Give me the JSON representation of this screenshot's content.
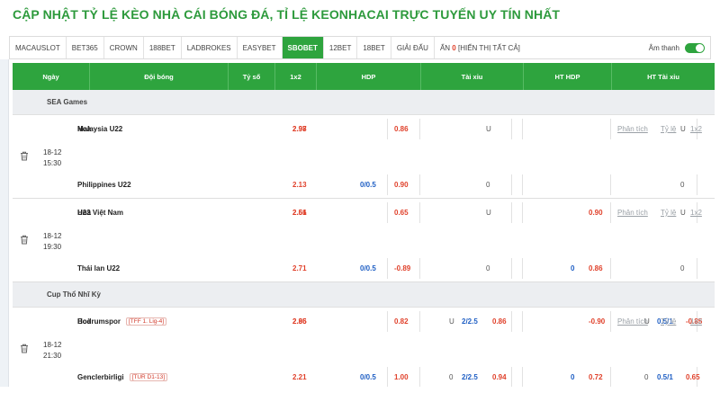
{
  "page": {
    "title": "CẬP NHẬT TỶ LỆ KÈO NHÀ CÁI BÓNG ĐÁ, TỈ LỆ KEONHACAI TRỰC TUYẾN UY TÍN NHẤT"
  },
  "tabs": [
    {
      "label": "MACAUSLOT",
      "active": false
    },
    {
      "label": "BET365",
      "active": false
    },
    {
      "label": "CROWN",
      "active": false
    },
    {
      "label": "188BET",
      "active": false
    },
    {
      "label": "LADBROKES",
      "active": false
    },
    {
      "label": "EASYBET",
      "active": false
    },
    {
      "label": "SBOBET",
      "active": true
    },
    {
      "label": "12BET",
      "active": false
    },
    {
      "label": "18BET",
      "active": false
    },
    {
      "label": "GIẢI ĐẤU",
      "active": false
    }
  ],
  "hide_bar": {
    "label": "ẨN",
    "count": "0",
    "show_all": "[HIỂN THỊ TẤT CẢ]"
  },
  "sound": {
    "label": "Âm thanh",
    "on": true
  },
  "header": {
    "date": "Ngày",
    "team": "Đội bóng",
    "score": "Tỷ số",
    "x12": "1x2",
    "hdp": "HDP",
    "ou": "Tài xỉu",
    "ht_hdp": "HT HDP",
    "ht_ou": "HT Tài xỉu"
  },
  "links": {
    "analysis": "Phân tích",
    "odds": "Tỷ lệ",
    "x12": "1x2"
  },
  "leagues": [
    {
      "name": "SEA Games",
      "matches": [
        {
          "date": "18-12",
          "time": "15:30",
          "rows": [
            {
              "team": "Philippines U22",
              "tag": "",
              "x12": "2.13",
              "hdp_line": "0/0.5",
              "hdp_odd": "0.90",
              "ou_label": "0",
              "ou_line": "",
              "ou_odd": "",
              "hthdp_line": "",
              "hthdp_odd": "",
              "htou_label": "0",
              "htou_line": "",
              "htou_odd": ""
            },
            {
              "team": "Malaysia U22",
              "tag": "",
              "x12": "2.97",
              "hdp_line": "",
              "hdp_odd": "0.86",
              "ou_label": "U",
              "ou_line": "",
              "ou_odd": "",
              "hthdp_line": "",
              "hthdp_odd": "",
              "htou_label": "U",
              "htou_line": "",
              "htou_odd": ""
            },
            {
              "team": "Hoà",
              "tag": "",
              "x12": "2.98"
            }
          ]
        }
      ]
    },
    {
      "name": "",
      "matches": [
        {
          "date": "18-12",
          "time": "19:30",
          "rows": [
            {
              "team": "Thái lan U22",
              "tag": "",
              "x12": "2.71",
              "hdp_line": "0/0.5",
              "hdp_odd": "-0.89",
              "ou_label": "0",
              "ou_line": "",
              "ou_odd": "",
              "hthdp_line": "0",
              "hthdp_odd": "0.86",
              "htou_label": "0",
              "htou_line": "",
              "htou_odd": ""
            },
            {
              "team": "U22 Việt Nam",
              "tag": "",
              "x12": "2.51",
              "hdp_line": "",
              "hdp_odd": "0.65",
              "ou_label": "U",
              "ou_line": "",
              "ou_odd": "",
              "hthdp_line": "",
              "hthdp_odd": "0.90",
              "htou_label": "U",
              "htou_line": "",
              "htou_odd": ""
            },
            {
              "team": "Hoà",
              "tag": "",
              "x12": "2.66"
            }
          ]
        }
      ]
    },
    {
      "name": "Cup Thổ Nhĩ Kỳ",
      "matches": [
        {
          "date": "18-12",
          "time": "21:30",
          "rows": [
            {
              "team": "Genclerbirligi",
              "tag": "[TUR D1-13]",
              "x12": "2.21",
              "hdp_line": "0/0.5",
              "hdp_odd": "1.00",
              "ou_label": "0",
              "ou_line": "2/2.5",
              "ou_odd": "0.94",
              "hthdp_line": "0",
              "hthdp_odd": "0.72",
              "htou_label": "0",
              "htou_line": "0.5/1",
              "htou_odd": "0.65"
            },
            {
              "team": "Bodrumspor",
              "tag": "[TFF 1. Lig-4]",
              "x12": "2.85",
              "hdp_line": "",
              "hdp_odd": "0.82",
              "ou_label": "U",
              "ou_line": "2/2.5",
              "ou_odd": "0.86",
              "hthdp_line": "",
              "hthdp_odd": "-0.90",
              "htou_label": "U",
              "htou_line": "0.5/1",
              "htou_odd": "-0.85"
            },
            {
              "team": "Hoà",
              "tag": "",
              "x12": "2.96"
            }
          ]
        }
      ]
    }
  ],
  "colors": {
    "accent": "#2ea43e",
    "odd": "#e0412b",
    "line": "#1f5fc4"
  }
}
